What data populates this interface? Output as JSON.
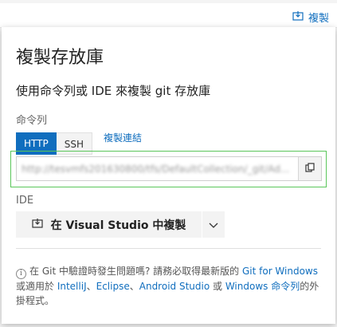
{
  "header": {
    "clone_label": "複製"
  },
  "panel": {
    "title": "複製存放庫",
    "subtitle": "使用命令列或 IDE 來複製 git 存放庫",
    "command_line_label": "命令列",
    "tabs": [
      {
        "label": "HTTP",
        "active": true
      },
      {
        "label": "SSH",
        "active": false
      }
    ],
    "copy_link_label": "複製連結",
    "clone_url": "http://tesvmfs201630800/tfs/DefaultCollection/_git/Ad...",
    "ide_label": "IDE",
    "ide_button_label": "在 Visual Studio 中複製",
    "info": {
      "text_1": "在 Git 中驗證時發生問題嗎? 請務必取得最新版的 ",
      "link_git_windows": "Git for Windows",
      "text_2": " 或適用於 ",
      "link_intellij": "IntelliJ",
      "sep_1": "、",
      "link_eclipse": "Eclipse",
      "sep_2": "、",
      "link_android": "Android Studio",
      "text_3": " 或 ",
      "link_windows_cmd": "Windows 命令列",
      "text_4": "的外掛程式。"
    }
  },
  "colors": {
    "accent": "#106ebe",
    "highlight": "#5ac65a"
  }
}
